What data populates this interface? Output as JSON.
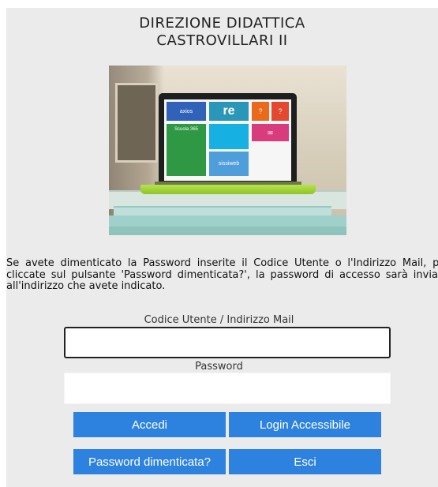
{
  "header": {
    "line1": "DIREZIONE DIDATTICA",
    "line2": "CASTROVILLARI II"
  },
  "hero": {
    "tiles": {
      "axios": "axios",
      "re": "re",
      "scuola": "Scuola 365",
      "sissi": "sissiweb"
    }
  },
  "info_text": "Se avete dimenticato la Password inserite il Codice Utente o l'Indirizzo Mail, poi cliccate sul pulsante 'Password dimenticata?', la password di accesso sarà inviata all'indirizzo che avete indicato.",
  "form": {
    "user_label": "Codice Utente / Indirizzo Mail",
    "user_value": "",
    "password_label": "Password",
    "password_value": ""
  },
  "buttons": {
    "accedi": "Accedi",
    "login_accessibile": "Login Accessibile",
    "password_dimenticata": "Password dimenticata?",
    "esci": "Esci"
  },
  "colors": {
    "panel_bg": "#ebebeb",
    "button_bg": "#2e82df",
    "button_text": "#ffffff"
  }
}
